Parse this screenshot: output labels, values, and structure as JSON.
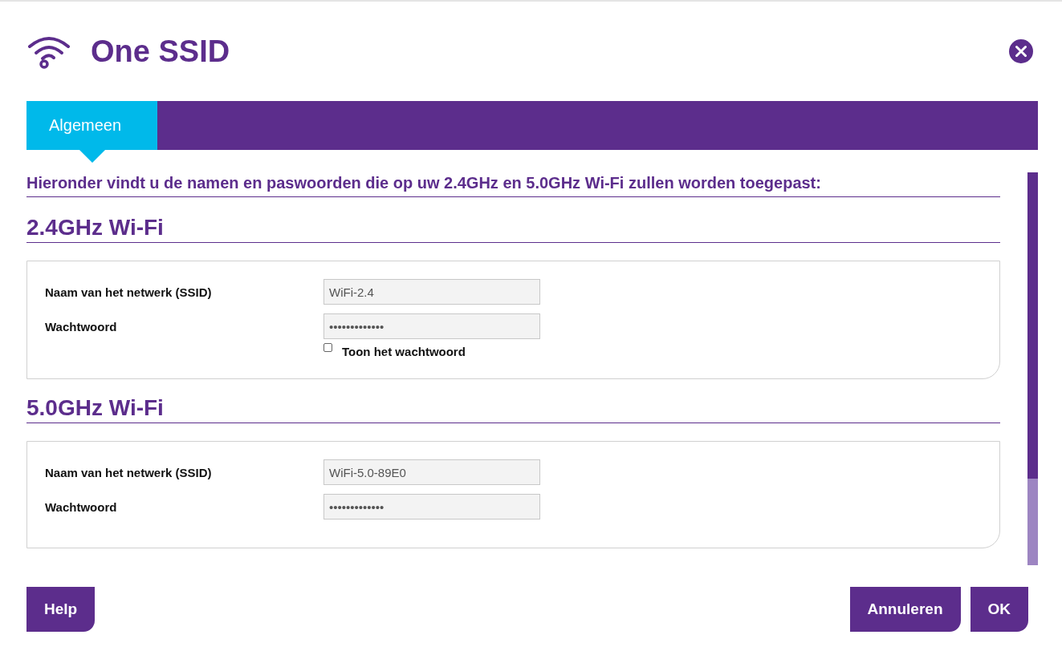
{
  "dialog": {
    "title": "One SSID",
    "tabs": [
      {
        "label": "Algemeen",
        "selected": true
      }
    ],
    "intro": "Hieronder vindt u de namen en paswoorden die op uw 2.4GHz en 5.0GHz Wi-Fi zullen worden toegepast:",
    "sections": [
      {
        "heading": "2.4GHz Wi-Fi",
        "fields": [
          {
            "label": "Naam van het netwerk (SSID)",
            "value": "WiFi-2.4"
          },
          {
            "label": "Wachtwoord",
            "value": "•••••••••••••"
          }
        ],
        "show_password": {
          "label": "Toon het wachtwoord",
          "checked": false
        }
      },
      {
        "heading": "5.0GHz Wi-Fi",
        "fields": [
          {
            "label": "Naam van het netwerk (SSID)",
            "value": "WiFi-5.0-89E0"
          },
          {
            "label": "Wachtwoord",
            "value": "•••••••••••••"
          }
        ]
      }
    ],
    "buttons": {
      "help": "Help",
      "cancel": "Annuleren",
      "ok": "OK"
    }
  }
}
